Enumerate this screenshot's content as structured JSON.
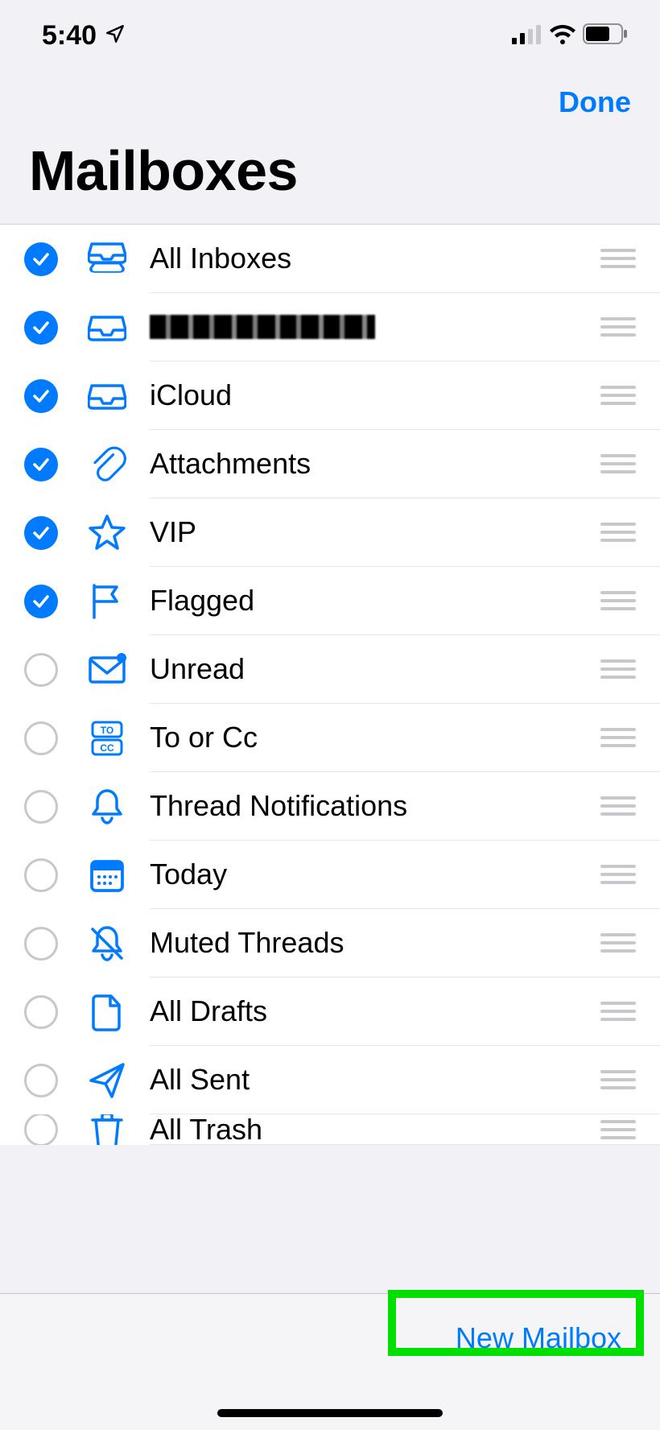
{
  "status": {
    "time": "5:40"
  },
  "nav": {
    "done": "Done"
  },
  "header": {
    "title": "Mailboxes"
  },
  "toolbar": {
    "new_mailbox": "New Mailbox"
  },
  "rows": [
    {
      "label": "All Inboxes",
      "checked": true,
      "icon": "inboxes-icon"
    },
    {
      "label": "[redacted account]",
      "checked": true,
      "icon": "tray-icon",
      "redacted": true
    },
    {
      "label": "iCloud",
      "checked": true,
      "icon": "tray-icon"
    },
    {
      "label": "Attachments",
      "checked": true,
      "icon": "paperclip-icon"
    },
    {
      "label": "VIP",
      "checked": true,
      "icon": "star-icon"
    },
    {
      "label": "Flagged",
      "checked": true,
      "icon": "flag-icon"
    },
    {
      "label": "Unread",
      "checked": false,
      "icon": "envelope-badge-icon"
    },
    {
      "label": "To or Cc",
      "checked": false,
      "icon": "to-cc-icon"
    },
    {
      "label": "Thread Notifications",
      "checked": false,
      "icon": "bell-icon"
    },
    {
      "label": "Today",
      "checked": false,
      "icon": "calendar-icon"
    },
    {
      "label": "Muted Threads",
      "checked": false,
      "icon": "bell-slash-icon"
    },
    {
      "label": "All Drafts",
      "checked": false,
      "icon": "document-icon"
    },
    {
      "label": "All Sent",
      "checked": false,
      "icon": "paperplane-icon"
    },
    {
      "label": "All Trash",
      "checked": false,
      "icon": "trash-icon",
      "partial": true
    }
  ]
}
